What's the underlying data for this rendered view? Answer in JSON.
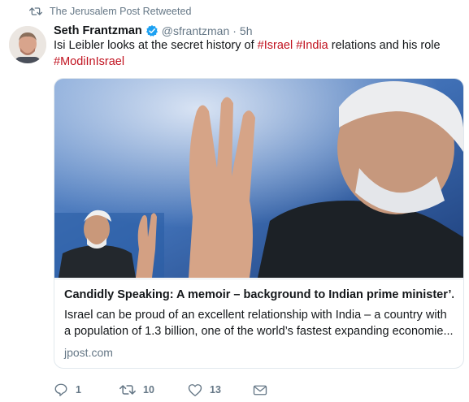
{
  "retweet_context": {
    "label": "The Jerusalem Post Retweeted"
  },
  "tweet": {
    "author_name": "Seth Frantzman",
    "handle": "@sfrantzman",
    "separator": "·",
    "time": "5h",
    "text_parts": [
      {
        "kind": "text",
        "value": "Isi Leibler looks at the secret history of "
      },
      {
        "kind": "hashtag",
        "value": "#Israel"
      },
      {
        "kind": "text",
        "value": " "
      },
      {
        "kind": "hashtag",
        "value": "#India"
      },
      {
        "kind": "text",
        "value": " relations and his role "
      },
      {
        "kind": "hashtag",
        "value": "#ModiInIsrael"
      }
    ]
  },
  "card": {
    "title": "Candidly Speaking: A memoir – background to Indian prime minister’...",
    "description": "Israel can be proud of an excellent relationship with India – a country with a population of 1.3 billion, one of the world’s fastest expanding economie...",
    "domain": "jpost.com"
  },
  "actions": {
    "reply_count": "1",
    "retweet_count": "10",
    "like_count": "13"
  },
  "colors": {
    "hashtag": "#c1121f",
    "verified_badge": "#1da1f2",
    "muted_text": "#657786"
  },
  "icons": [
    "retweet-icon",
    "verified-badge-icon",
    "reply-icon",
    "like-icon",
    "direct-message-icon"
  ]
}
